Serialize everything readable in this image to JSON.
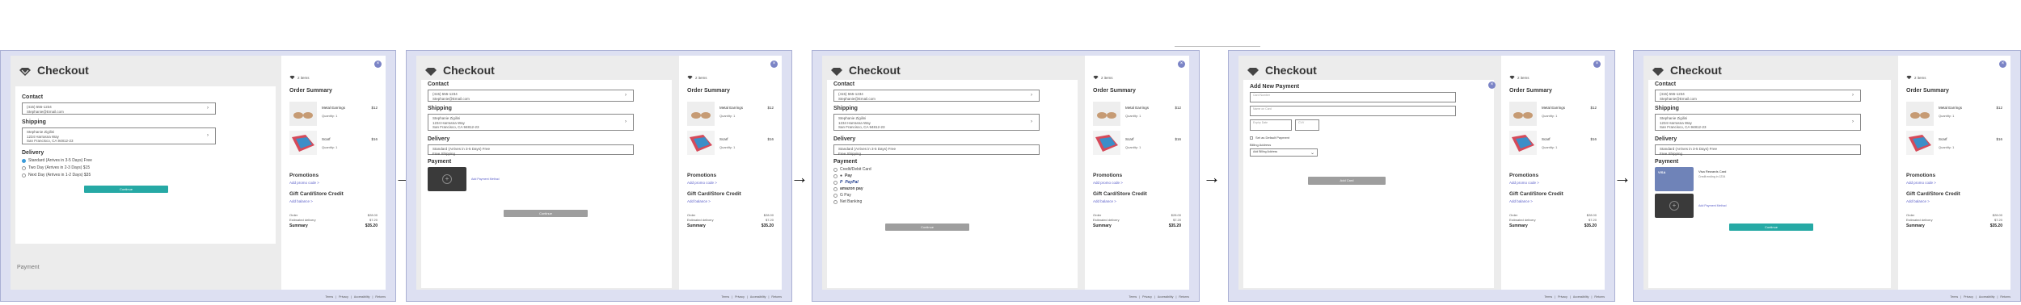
{
  "checkout": {
    "title": "Checkout",
    "items": "2 items",
    "order_summary": "Order Summary",
    "contact": "Contact",
    "contact_line1": "(415) 555-1234",
    "contact_line2": "Stephanie@Email.com",
    "shipping": "Shipping",
    "ship_line1": "Stephanie Zigilini",
    "ship_line2": "1234 Harrasna Way",
    "ship_line3": "San Francisco, CA 94812-23",
    "delivery": "Delivery",
    "d_standard": "Standard (Arrives in 3-5 Days) Free",
    "d_twoday": "Two Day (Arrives in 2-3 Days) $15",
    "d_nextday": "Next Day (Arrives in 1-2 Days) $35",
    "d_selected": "Standard (Arrives in 3-5 Days) Free",
    "d_selected_sub": "Free Shipping",
    "payment": "Payment",
    "continue": "Continue",
    "add_payment": "Add Payment Method",
    "p1_name": "Metal Earrings",
    "p1_qty": "Quantity: 1",
    "p1_price": "$12",
    "p2_name": "Scarf",
    "p2_qty": "Quantity: 1",
    "p2_price": "$16",
    "promotions": "Promotions",
    "add_promo": "Add promo code >",
    "gift": "Gift Card/Store Credit",
    "add_balance": "Add balance >",
    "order_label": "Order",
    "order_value": "$28.00",
    "est_label": "Estimated delivery",
    "est_value": "$7.20",
    "summary_label": "Summary",
    "summary_value": "$35.20",
    "pm_card": "Credit/Debit Card",
    "pm_apple": "Pay",
    "pm_paypal": "PayPal",
    "pm_amazon": "amazon pay",
    "pm_google": "G Pay",
    "pm_bank": "Net Banking",
    "new_payment": "Add New Payment",
    "card_number": "Card Number",
    "name_on_card": "Name on Card",
    "exp": "Expiry Date",
    "cvv": "CVV",
    "default": "Set as Default Payment",
    "billing": "Billing Address",
    "billing_select": "Add Billing Address",
    "save": "Add Card",
    "saved_card": "Visa Rewards Card",
    "saved_card_sub": "Credit ending in 1234",
    "footer": [
      "Terms",
      "Privacy",
      "Accessibility",
      "Returns"
    ]
  },
  "colors": {
    "accent": "#26a9a5",
    "link": "#5a5ec9",
    "close": "#7b84c6",
    "frame": "#dde0f2"
  }
}
